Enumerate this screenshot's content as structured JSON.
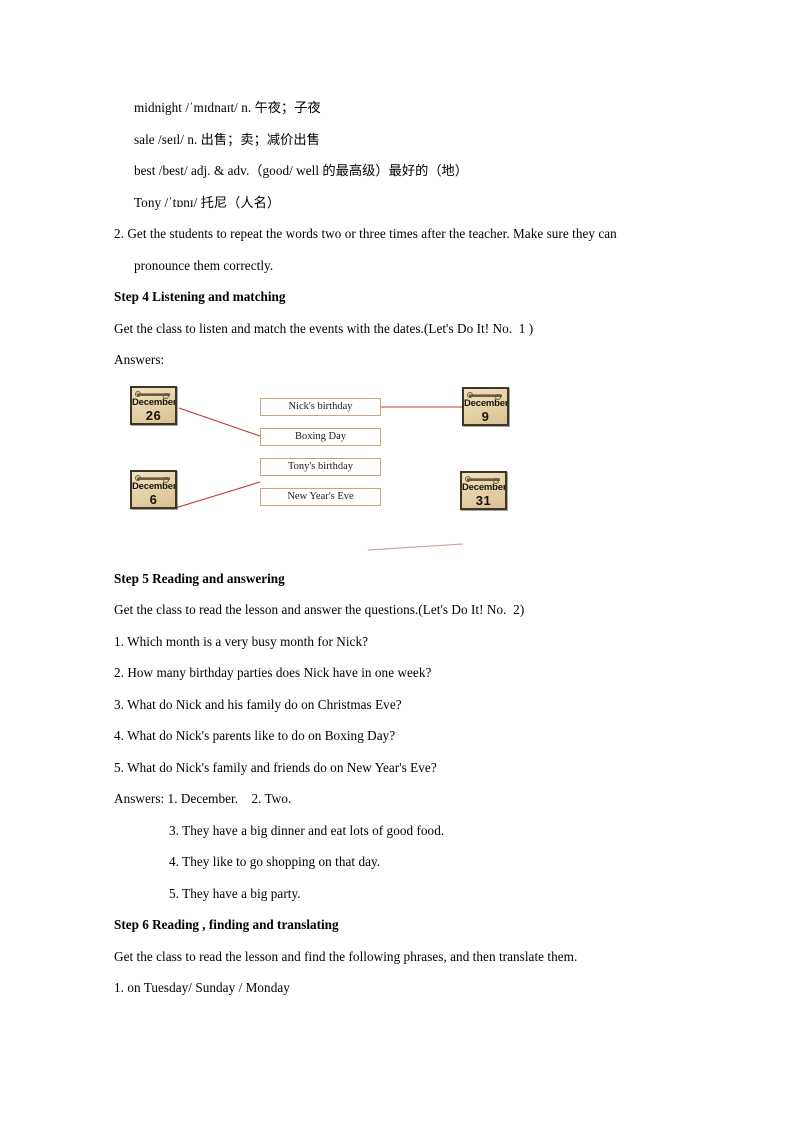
{
  "document": {
    "vocab": [
      "midnight /ˈmɪdnaɪt/ n. 午夜；子夜",
      "sale /seɪl/ n. 出售；卖；减价出售",
      "best /best/ adj. & adv.（good/ well 的最高级）最好的（地）",
      "Tony /ˈtɒnɪ/ 托尼（人名）"
    ],
    "instruction_2_line1": "2. Get the students to repeat the words two or three times after the teacher. Make sure they can",
    "instruction_2_line2": "pronounce them correctly.",
    "step4": {
      "heading": "Step 4    Listening and matching",
      "intro": "Get the class to listen and match the events with the dates.(Let's Do It! No.  1 )",
      "answers_label": "Answers:"
    },
    "diagram": {
      "calendars": [
        {
          "month": "December",
          "day": "26"
        },
        {
          "month": "December",
          "day": "9"
        },
        {
          "month": "December",
          "day": "6"
        },
        {
          "month": "December",
          "day": "31"
        }
      ],
      "events": [
        "Nick's birthday",
        "Boxing Day",
        "Tony's birthday",
        "New Year's Eve"
      ],
      "connector_color": "#c0392b"
    },
    "step5": {
      "heading": "Step 5    Reading and answering",
      "intro": "Get the class to read the lesson and answer the questions.(Let's Do It! No.  2)",
      "questions": [
        "1. Which month is a very busy month for Nick?",
        "2. How many birthday parties does Nick have in one week?",
        "3. What do Nick and his family do on Christmas Eve?",
        "4. What do Nick's parents like to do on Boxing Day?",
        "5. What do Nick's family and friends do on New Year's Eve?"
      ],
      "answers_line1": "Answers: 1. December.    2. Two.",
      "answers_rest": [
        "3. They have a big dinner and eat lots of good food.",
        "4. They like to go shopping on that day.",
        "5. They have a big party."
      ]
    },
    "step6": {
      "heading": "Step 6 Reading , finding and translating",
      "intro": "Get the class to read the lesson and find the following phrases, and then translate them.",
      "items": [
        "1. on Tuesday/ Sunday / Monday"
      ]
    }
  }
}
